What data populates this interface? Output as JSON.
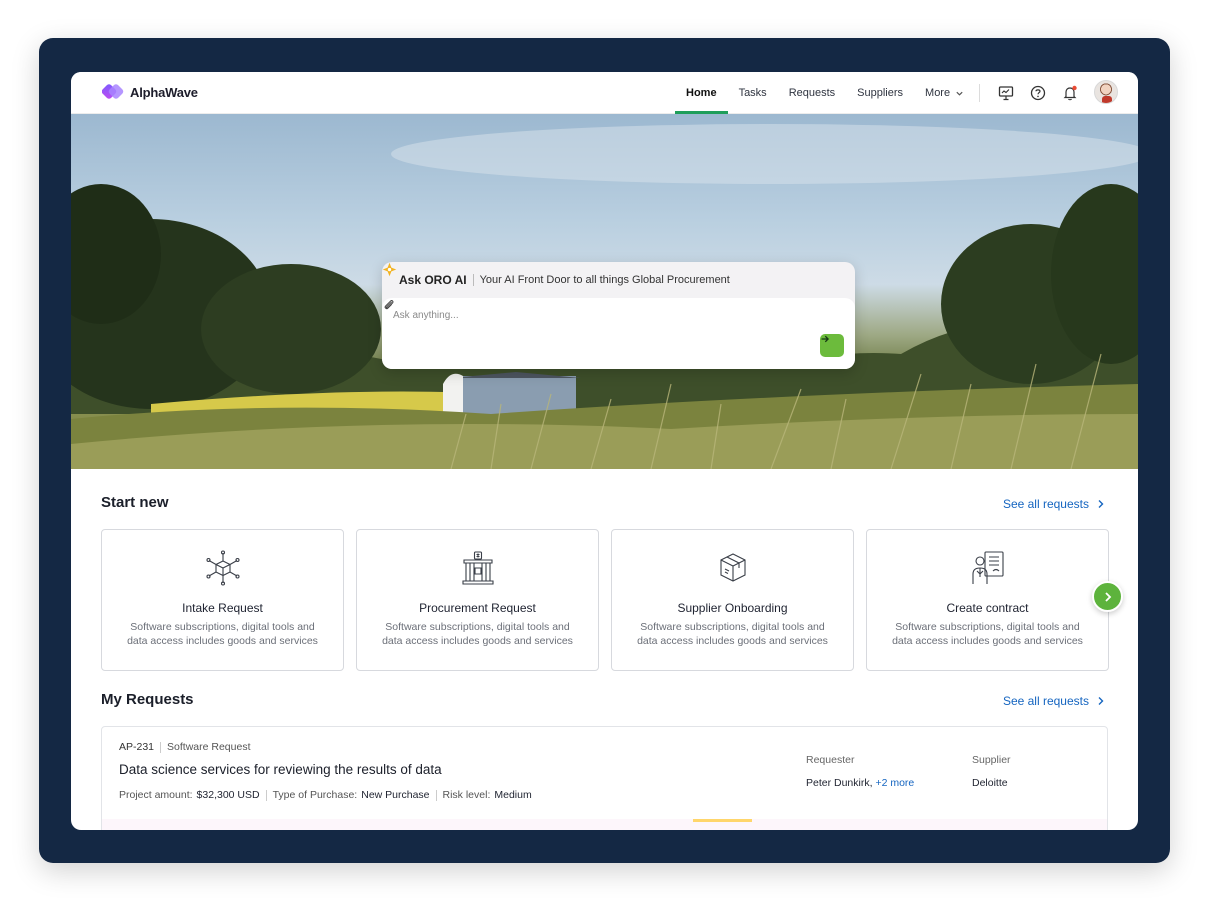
{
  "app": {
    "logo_text": "AlphaWave"
  },
  "nav": {
    "items": [
      "Home",
      "Tasks",
      "Requests",
      "Suppliers"
    ],
    "more_label": "More",
    "active": "Home"
  },
  "ai": {
    "title": "Ask ORO AI",
    "subtitle": "Your AI Front Door to all things Global Procurement",
    "placeholder": "Ask anything..."
  },
  "start_new": {
    "title": "Start new",
    "see_all": "See all requests",
    "cards": [
      {
        "title": "Intake Request",
        "desc": "Software subscriptions, digital tools and data access includes goods and services",
        "icon": "cube-network-icon"
      },
      {
        "title": "Procurement Request",
        "desc": "Software subscriptions, digital tools and data access includes goods and services",
        "icon": "bank-building-icon"
      },
      {
        "title": "Supplier Onboarding",
        "desc": "Software subscriptions, digital tools and data access includes goods and services",
        "icon": "package-box-icon"
      },
      {
        "title": "Create contract",
        "desc": "Software subscriptions, digital tools and data access includes goods and services",
        "icon": "contract-person-icon"
      }
    ]
  },
  "my_requests": {
    "title": "My Requests",
    "see_all": "See all requests",
    "items": [
      {
        "id": "AP-231",
        "type": "Software Request",
        "title": "Data science services for reviewing the results of data",
        "amount_label": "Project amount:",
        "amount": "$32,300 USD",
        "purchase_label": "Type of Purchase:",
        "purchase": "New Purchase",
        "risk_label": "Risk level:",
        "risk": "Medium",
        "requester_label": "Requester",
        "requester": "Peter Dunkirk,",
        "requester_more": "+2 more",
        "supplier_label": "Supplier",
        "supplier": "Deloitte"
      }
    ]
  },
  "colors": {
    "accent_green": "#1e9e5a",
    "send_green": "#6cbb3c",
    "link_blue": "#1565c0",
    "device_frame": "#142844"
  }
}
